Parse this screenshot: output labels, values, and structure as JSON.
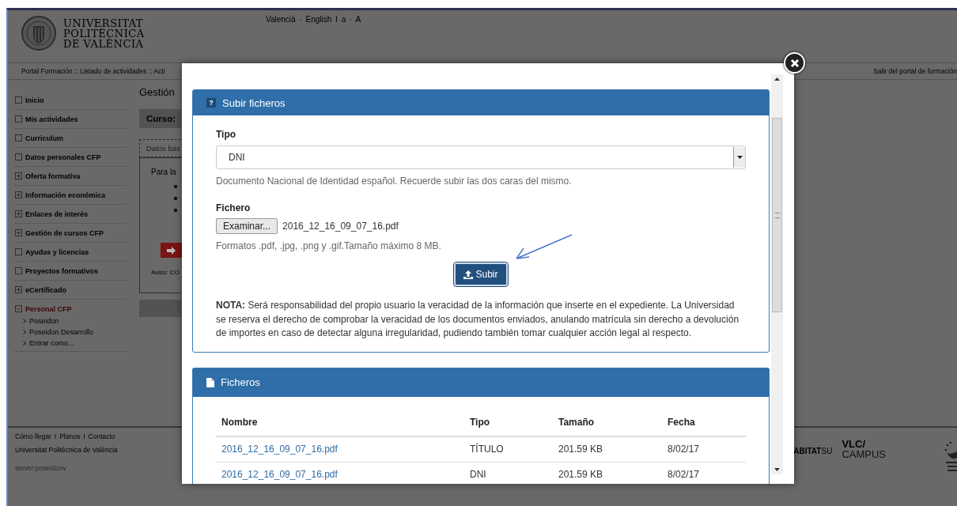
{
  "header": {
    "university_name": [
      "UNIVERSITAT",
      "POLITÈCNICA",
      "DE VALÈNCIA"
    ],
    "language_links": "Valencià · English I a · A"
  },
  "nav": {
    "breadcrumb": "Portal Formación :: Listado de actividades :: Acti",
    "logout": "Salir del portal de formación"
  },
  "sidebar": {
    "items": [
      {
        "label": "Inicio",
        "kind": "page"
      },
      {
        "label": "Mis actividades",
        "kind": "page"
      },
      {
        "label": "Curriculum",
        "kind": "page"
      },
      {
        "label": "Datos personales CFP",
        "kind": "page"
      },
      {
        "label": "Oferta formativa",
        "kind": "group",
        "expanded": false
      },
      {
        "label": "Información económica",
        "kind": "group",
        "expanded": false
      },
      {
        "label": "Enlaces de interés",
        "kind": "group",
        "expanded": false
      },
      {
        "label": "Gestión de cursos CFP",
        "kind": "group",
        "expanded": false
      },
      {
        "label": "Ayudas y licencias",
        "kind": "page"
      },
      {
        "label": "Proyectos formativos",
        "kind": "page"
      },
      {
        "label": "eCertificado",
        "kind": "group",
        "expanded": false
      },
      {
        "label": "Personal CFP",
        "kind": "group",
        "expanded": true,
        "children": [
          "Poseidon",
          "Poseidon Desarrollo",
          "Entrar como..."
        ]
      }
    ]
  },
  "main": {
    "title": "Gestión",
    "course": "Curso:",
    "tab": "Datos bás",
    "intro": "Para la",
    "notice": "Aviso: CO"
  },
  "footer": {
    "links": [
      "Cómo llegar",
      "Planos",
      "Contacto"
    ],
    "separators": [
      "I",
      "I"
    ],
    "university": "Universitat Politècnica de València",
    "server": "server:poseidonv",
    "partner_logo": "**ABITAT**SU",
    "campus_logo": [
      "VLC/",
      "CAMPUS"
    ]
  },
  "modal": {
    "upload_panel": {
      "header_icon": "?",
      "title": "Subir ficheros",
      "type_label": "Tipo",
      "type_value": "DNI",
      "type_help": "Documento Nacional de Identidad español. Recuerde subir las dos caras del mismo.",
      "file_label": "Fichero",
      "browse_button": "Examinar...",
      "file_name": "2016_12_16_09_07_16.pdf",
      "file_help": "Formatos .pdf, .jpg, .png y .gif.Tamaño máximo 8 MB.",
      "upload_button": "Subir",
      "note": "**NOTA:** Será responsabilidad del propio usuario la veracidad de la información que inserte en el expediente. La Universidad se reserva el derecho de comprobar la veracidad de los documentos enviados, anulando matrícula sin derecho a devolución de importes en caso de detectar alguna irregularidad, pudiendo también tomar cualquier acción legal al respecto."
    },
    "files_panel": {
      "title": "Ficheros",
      "columns": [
        "Nombre",
        "Tipo",
        "Tamaño",
        "Fecha"
      ],
      "rows": [
        {
          "name": "2016_12_16_09_07_16.pdf",
          "type": "TÍTULO",
          "size": "201.59 KB",
          "date": "8/02/17"
        },
        {
          "name": "2016_12_16_09_07_16.pdf",
          "type": "DNI",
          "size": "201.59 KB",
          "date": "8/02/17"
        }
      ]
    }
  }
}
